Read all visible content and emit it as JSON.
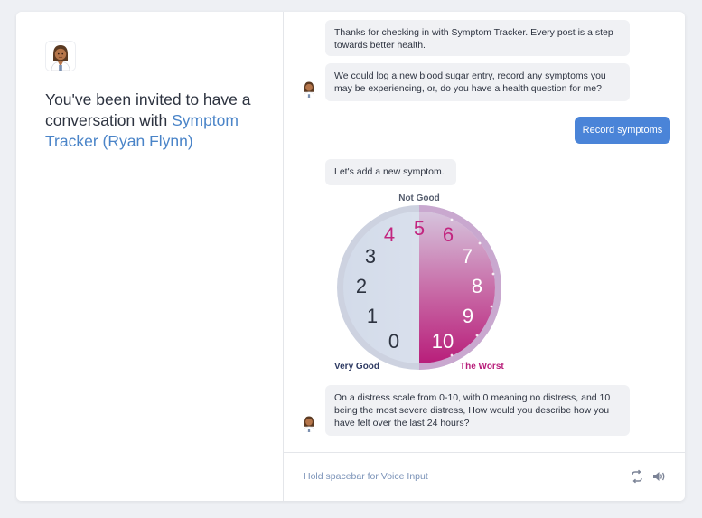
{
  "invite": {
    "prefix": "You've been invited to have a conversation with ",
    "name": "Symptom Tracker (Ryan Flynn)"
  },
  "messages": [
    {
      "text": "Thanks for checking in with Symptom Tracker. Every post is a step towards better health."
    },
    {
      "text": "We could log a new blood sugar entry, record any symptoms you may be experiencing, or, do you have a health question for me?"
    },
    {
      "text": "Record symptoms"
    },
    {
      "text": "Let's add a new symptom."
    },
    {
      "text": "On a distress scale from 0-10, with 0 meaning no distress, and 10 being the most severe distress, How would you describe how you have felt over the last 24 hours?"
    }
  ],
  "scale": {
    "top_label": "Not Good",
    "left_label": "Very Good",
    "right_label": "The Worst",
    "numbers": [
      "0",
      "1",
      "2",
      "3",
      "4",
      "5",
      "6",
      "7",
      "8",
      "9",
      "10"
    ]
  },
  "footer": {
    "hint": "Hold spacebar for Voice Input"
  },
  "icons": [
    "doctor-avatar",
    "refresh-icon",
    "speaker-icon"
  ],
  "colors": {
    "accent": "#4a84c8",
    "user_bubble": "#4a84d8",
    "magenta": "#c2257f"
  }
}
